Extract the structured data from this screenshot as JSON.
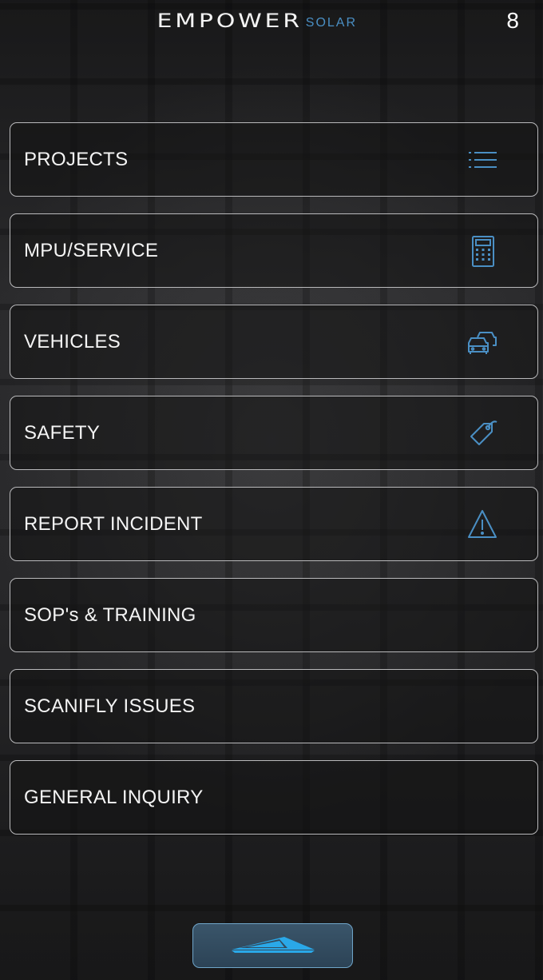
{
  "header": {
    "logo_main": "EMPOWER",
    "logo_sub": "SOLAR",
    "badge": "8"
  },
  "menu": {
    "items": [
      {
        "label": "PROJECTS",
        "icon": "list-icon"
      },
      {
        "label": "MPU/SERVICE",
        "icon": "calculator-icon"
      },
      {
        "label": "VEHICLES",
        "icon": "cars-icon"
      },
      {
        "label": "SAFETY",
        "icon": "tag-icon"
      },
      {
        "label": "REPORT INCIDENT",
        "icon": "warning-icon"
      },
      {
        "label": "SOP's & TRAINING",
        "icon": ""
      },
      {
        "label": "SCANIFLY ISSUES",
        "icon": ""
      },
      {
        "label": "GENERAL INQUIRY",
        "icon": ""
      }
    ]
  },
  "footer": {
    "home_icon": "solar-panel-logo-icon"
  },
  "colors": {
    "accent": "#4a8fc4",
    "button_fill": "#324b5f",
    "button_border": "#6fa5c9",
    "card_border": "#b9b9bb"
  }
}
